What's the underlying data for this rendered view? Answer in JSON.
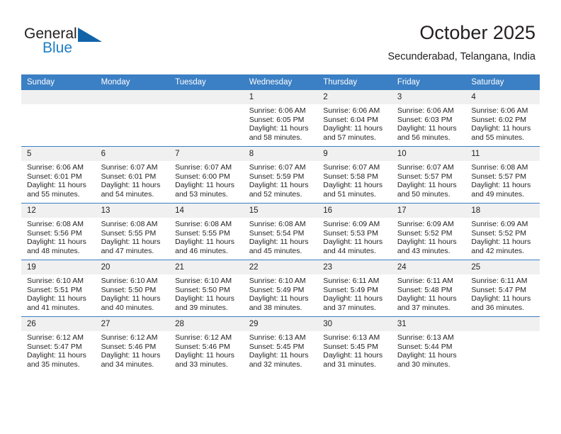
{
  "brand": {
    "name_part1": "General",
    "name_part2": "Blue",
    "logo_icon": "triangle-flag-icon"
  },
  "header": {
    "title": "October 2025",
    "location": "Secunderabad, Telangana, India"
  },
  "weekday_headers": [
    "Sunday",
    "Monday",
    "Tuesday",
    "Wednesday",
    "Thursday",
    "Friday",
    "Saturday"
  ],
  "colors": {
    "header_blue": "#3b7fc4",
    "brand_blue": "#1f7ec4",
    "logo_blue": "#1264a9",
    "daynum_band": "#f0f0f0",
    "text": "#231f20"
  },
  "weeks": [
    [
      {
        "day": "",
        "lines": []
      },
      {
        "day": "",
        "lines": []
      },
      {
        "day": "",
        "lines": []
      },
      {
        "day": "1",
        "lines": [
          "Sunrise: 6:06 AM",
          "Sunset: 6:05 PM",
          "Daylight: 11 hours",
          "and 58 minutes."
        ]
      },
      {
        "day": "2",
        "lines": [
          "Sunrise: 6:06 AM",
          "Sunset: 6:04 PM",
          "Daylight: 11 hours",
          "and 57 minutes."
        ]
      },
      {
        "day": "3",
        "lines": [
          "Sunrise: 6:06 AM",
          "Sunset: 6:03 PM",
          "Daylight: 11 hours",
          "and 56 minutes."
        ]
      },
      {
        "day": "4",
        "lines": [
          "Sunrise: 6:06 AM",
          "Sunset: 6:02 PM",
          "Daylight: 11 hours",
          "and 55 minutes."
        ]
      }
    ],
    [
      {
        "day": "5",
        "lines": [
          "Sunrise: 6:06 AM",
          "Sunset: 6:01 PM",
          "Daylight: 11 hours",
          "and 55 minutes."
        ]
      },
      {
        "day": "6",
        "lines": [
          "Sunrise: 6:07 AM",
          "Sunset: 6:01 PM",
          "Daylight: 11 hours",
          "and 54 minutes."
        ]
      },
      {
        "day": "7",
        "lines": [
          "Sunrise: 6:07 AM",
          "Sunset: 6:00 PM",
          "Daylight: 11 hours",
          "and 53 minutes."
        ]
      },
      {
        "day": "8",
        "lines": [
          "Sunrise: 6:07 AM",
          "Sunset: 5:59 PM",
          "Daylight: 11 hours",
          "and 52 minutes."
        ]
      },
      {
        "day": "9",
        "lines": [
          "Sunrise: 6:07 AM",
          "Sunset: 5:58 PM",
          "Daylight: 11 hours",
          "and 51 minutes."
        ]
      },
      {
        "day": "10",
        "lines": [
          "Sunrise: 6:07 AM",
          "Sunset: 5:57 PM",
          "Daylight: 11 hours",
          "and 50 minutes."
        ]
      },
      {
        "day": "11",
        "lines": [
          "Sunrise: 6:08 AM",
          "Sunset: 5:57 PM",
          "Daylight: 11 hours",
          "and 49 minutes."
        ]
      }
    ],
    [
      {
        "day": "12",
        "lines": [
          "Sunrise: 6:08 AM",
          "Sunset: 5:56 PM",
          "Daylight: 11 hours",
          "and 48 minutes."
        ]
      },
      {
        "day": "13",
        "lines": [
          "Sunrise: 6:08 AM",
          "Sunset: 5:55 PM",
          "Daylight: 11 hours",
          "and 47 minutes."
        ]
      },
      {
        "day": "14",
        "lines": [
          "Sunrise: 6:08 AM",
          "Sunset: 5:55 PM",
          "Daylight: 11 hours",
          "and 46 minutes."
        ]
      },
      {
        "day": "15",
        "lines": [
          "Sunrise: 6:08 AM",
          "Sunset: 5:54 PM",
          "Daylight: 11 hours",
          "and 45 minutes."
        ]
      },
      {
        "day": "16",
        "lines": [
          "Sunrise: 6:09 AM",
          "Sunset: 5:53 PM",
          "Daylight: 11 hours",
          "and 44 minutes."
        ]
      },
      {
        "day": "17",
        "lines": [
          "Sunrise: 6:09 AM",
          "Sunset: 5:52 PM",
          "Daylight: 11 hours",
          "and 43 minutes."
        ]
      },
      {
        "day": "18",
        "lines": [
          "Sunrise: 6:09 AM",
          "Sunset: 5:52 PM",
          "Daylight: 11 hours",
          "and 42 minutes."
        ]
      }
    ],
    [
      {
        "day": "19",
        "lines": [
          "Sunrise: 6:10 AM",
          "Sunset: 5:51 PM",
          "Daylight: 11 hours",
          "and 41 minutes."
        ]
      },
      {
        "day": "20",
        "lines": [
          "Sunrise: 6:10 AM",
          "Sunset: 5:50 PM",
          "Daylight: 11 hours",
          "and 40 minutes."
        ]
      },
      {
        "day": "21",
        "lines": [
          "Sunrise: 6:10 AM",
          "Sunset: 5:50 PM",
          "Daylight: 11 hours",
          "and 39 minutes."
        ]
      },
      {
        "day": "22",
        "lines": [
          "Sunrise: 6:10 AM",
          "Sunset: 5:49 PM",
          "Daylight: 11 hours",
          "and 38 minutes."
        ]
      },
      {
        "day": "23",
        "lines": [
          "Sunrise: 6:11 AM",
          "Sunset: 5:49 PM",
          "Daylight: 11 hours",
          "and 37 minutes."
        ]
      },
      {
        "day": "24",
        "lines": [
          "Sunrise: 6:11 AM",
          "Sunset: 5:48 PM",
          "Daylight: 11 hours",
          "and 37 minutes."
        ]
      },
      {
        "day": "25",
        "lines": [
          "Sunrise: 6:11 AM",
          "Sunset: 5:47 PM",
          "Daylight: 11 hours",
          "and 36 minutes."
        ]
      }
    ],
    [
      {
        "day": "26",
        "lines": [
          "Sunrise: 6:12 AM",
          "Sunset: 5:47 PM",
          "Daylight: 11 hours",
          "and 35 minutes."
        ]
      },
      {
        "day": "27",
        "lines": [
          "Sunrise: 6:12 AM",
          "Sunset: 5:46 PM",
          "Daylight: 11 hours",
          "and 34 minutes."
        ]
      },
      {
        "day": "28",
        "lines": [
          "Sunrise: 6:12 AM",
          "Sunset: 5:46 PM",
          "Daylight: 11 hours",
          "and 33 minutes."
        ]
      },
      {
        "day": "29",
        "lines": [
          "Sunrise: 6:13 AM",
          "Sunset: 5:45 PM",
          "Daylight: 11 hours",
          "and 32 minutes."
        ]
      },
      {
        "day": "30",
        "lines": [
          "Sunrise: 6:13 AM",
          "Sunset: 5:45 PM",
          "Daylight: 11 hours",
          "and 31 minutes."
        ]
      },
      {
        "day": "31",
        "lines": [
          "Sunrise: 6:13 AM",
          "Sunset: 5:44 PM",
          "Daylight: 11 hours",
          "and 30 minutes."
        ]
      },
      {
        "day": "",
        "lines": []
      }
    ]
  ]
}
